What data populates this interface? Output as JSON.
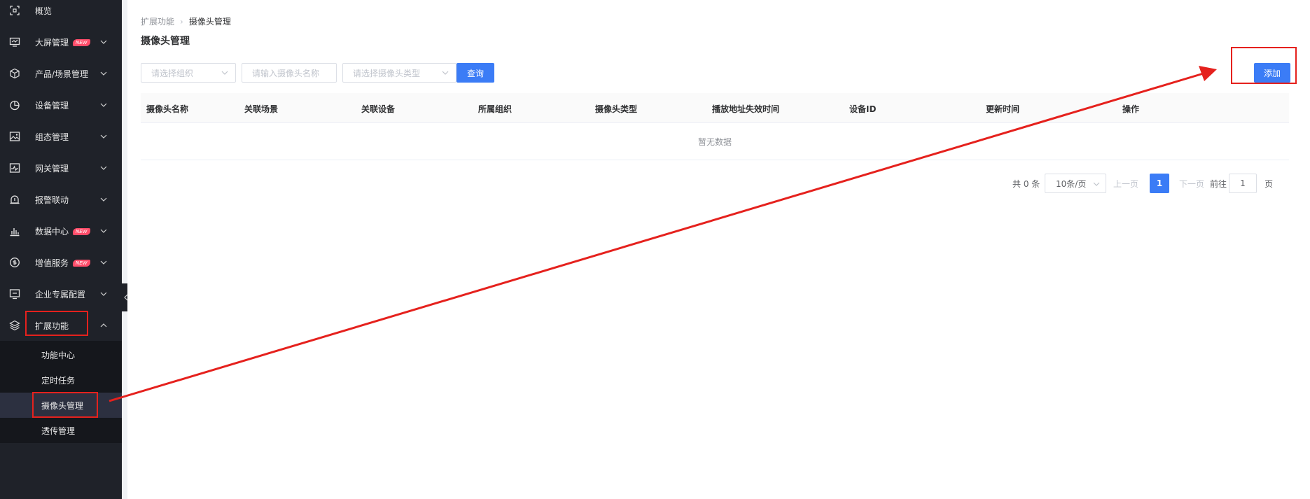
{
  "sidebar": {
    "items": [
      {
        "label": "概览",
        "icon": "overview-icon"
      },
      {
        "label": "大屏管理",
        "icon": "screen-icon",
        "badge": "NEW"
      },
      {
        "label": "产品/场景管理",
        "icon": "cube-icon"
      },
      {
        "label": "设备管理",
        "icon": "pie-chart-icon"
      },
      {
        "label": "组态管理",
        "icon": "image-icon"
      },
      {
        "label": "网关管理",
        "icon": "gateway-icon"
      },
      {
        "label": "报警联动",
        "icon": "alarm-icon"
      },
      {
        "label": "数据中心",
        "icon": "bar-chart-icon",
        "badge": "NEW"
      },
      {
        "label": "增值服务",
        "icon": "value-service-icon",
        "badge": "NEW"
      },
      {
        "label": "企业专属配置",
        "icon": "enterprise-icon"
      },
      {
        "label": "扩展功能",
        "icon": "layers-icon"
      }
    ],
    "submenu": [
      {
        "label": "功能中心"
      },
      {
        "label": "定时任务"
      },
      {
        "label": "摄像头管理"
      },
      {
        "label": "透传管理"
      }
    ]
  },
  "breadcrumb": {
    "parent": "扩展功能",
    "current": "摄像头管理"
  },
  "page_title": "摄像头管理",
  "filters": {
    "org_placeholder": "请选择组织",
    "name_placeholder": "请输入摄像头名称",
    "type_placeholder": "请选择摄像头类型",
    "query_label": "查询"
  },
  "add_label": "添加",
  "table": {
    "columns": [
      "摄像头名称",
      "关联场景",
      "关联设备",
      "所属组织",
      "摄像头类型",
      "播放地址失效时间",
      "设备ID",
      "更新时间",
      "操作"
    ],
    "empty_text": "暂无数据"
  },
  "pagination": {
    "total": "共 0 条",
    "page_size": "10条/页",
    "prev": "上一页",
    "current_page": "1",
    "next": "下一页",
    "goto_label": "前往",
    "goto_value": "1",
    "page_suffix": "页"
  },
  "colors": {
    "sidebar_bg": "#1f2229",
    "primary": "#3b7cf6",
    "annotation_red": "#e5211d",
    "badge": "#ff4d6a"
  }
}
